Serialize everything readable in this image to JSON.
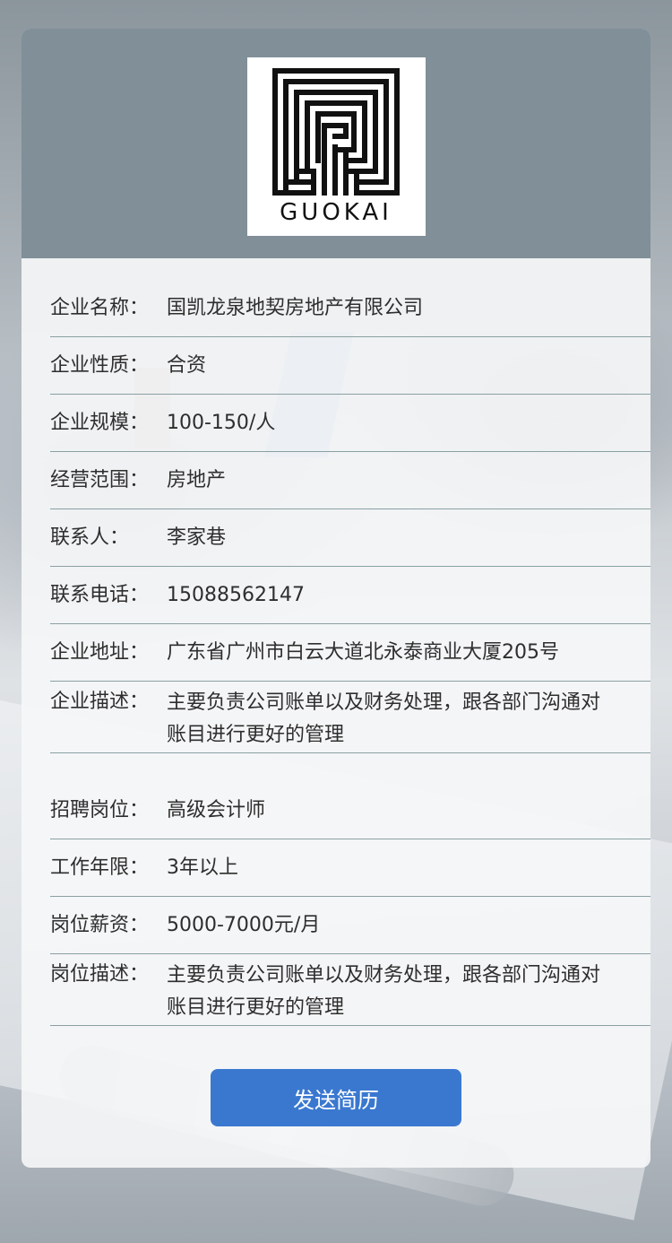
{
  "logo": {
    "text": "GUOKAI",
    "icon": "maze-logo-icon"
  },
  "company": [
    {
      "label": "企业名称：",
      "value": "国凯龙泉地契房地产有限公司"
    },
    {
      "label": "企业性质：",
      "value": "合资"
    },
    {
      "label": "企业规模：",
      "value": "100-150/人"
    },
    {
      "label": "经营范围：",
      "value": "房地产"
    },
    {
      "label": "联系人：",
      "value": "李家巷"
    },
    {
      "label": "联系电话：",
      "value": "15088562147"
    },
    {
      "label": "企业地址：",
      "value": "广东省广州市白云大道北永泰商业大厦205号"
    },
    {
      "label": "企业描述：",
      "value": "主要负责公司账单以及财务处理，跟各部门沟通对账目进行更好的管理"
    }
  ],
  "job": [
    {
      "label": "招聘岗位：",
      "value": "高级会计师"
    },
    {
      "label": "工作年限：",
      "value": "3年以上"
    },
    {
      "label": "岗位薪资：",
      "value": "5000-7000元/月"
    },
    {
      "label": "岗位描述：",
      "value": "主要负责公司账单以及财务处理，跟各部门沟通对账目进行更好的管理"
    }
  ],
  "button": {
    "label": "发送简历"
  },
  "colors": {
    "header": "#808f98",
    "button": "#3a78d0",
    "divider": "#8aa0a3"
  }
}
